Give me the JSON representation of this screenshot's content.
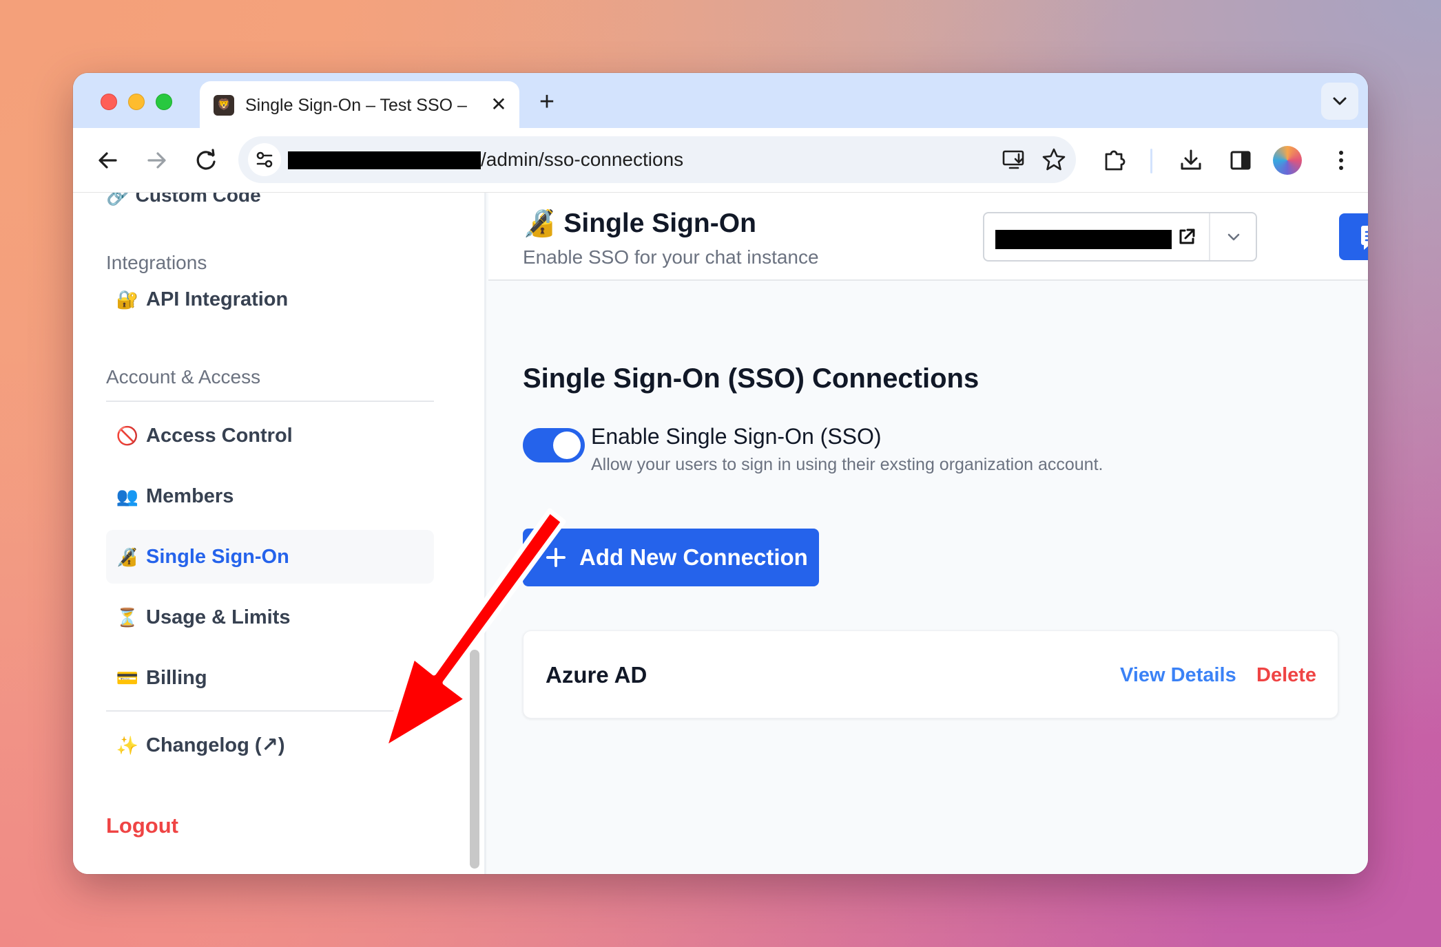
{
  "browser": {
    "tab_title": "Single Sign-On – Test SSO –",
    "tab_favicon": "🦁",
    "tab_close": "✕",
    "new_tab": "+",
    "url_visible": "/admin/sso-connections"
  },
  "sidebar": {
    "partial_item": "🔗 Custom Code",
    "sections": {
      "integrations": "Integrations",
      "account_access": "Account & Access"
    },
    "items": [
      {
        "emoji": "🔐",
        "label": "API Integration"
      },
      {
        "emoji": "🚫",
        "label": "Access Control"
      },
      {
        "emoji": "👥",
        "label": "Members"
      },
      {
        "emoji": "🔏",
        "label": "Single Sign-On"
      },
      {
        "emoji": "⏳",
        "label": "Usage & Limits"
      },
      {
        "emoji": "💳",
        "label": "Billing"
      },
      {
        "emoji": "✨",
        "label": "Changelog (↗)"
      }
    ],
    "logout": "Logout"
  },
  "header": {
    "title": "🔏 Single Sign-On",
    "subtitle": "Enable SSO for your chat instance"
  },
  "main": {
    "section_title": "Single Sign-On (SSO) Connections",
    "toggle": {
      "label": "Enable Single Sign-On (SSO)",
      "description": "Allow your users to sign in using their exsting organization account.",
      "enabled": true
    },
    "add_button": "Add New Connection",
    "connections": [
      {
        "name": "Azure AD",
        "view": "View Details",
        "delete": "Delete"
      }
    ]
  },
  "colors": {
    "accent": "#2563eb",
    "danger": "#ef4444",
    "annotation_arrow": "#ff0000"
  },
  "icons": {
    "back": "arrow-left-icon",
    "forward": "arrow-right-icon",
    "reload": "reload-icon",
    "install": "install-app-icon",
    "bookmark": "star-icon",
    "extensions": "puzzle-icon",
    "downloads": "download-icon",
    "sidepanel": "side-panel-icon",
    "menu": "kebab-menu-icon",
    "external": "external-link-icon",
    "chat": "chat-icon"
  }
}
